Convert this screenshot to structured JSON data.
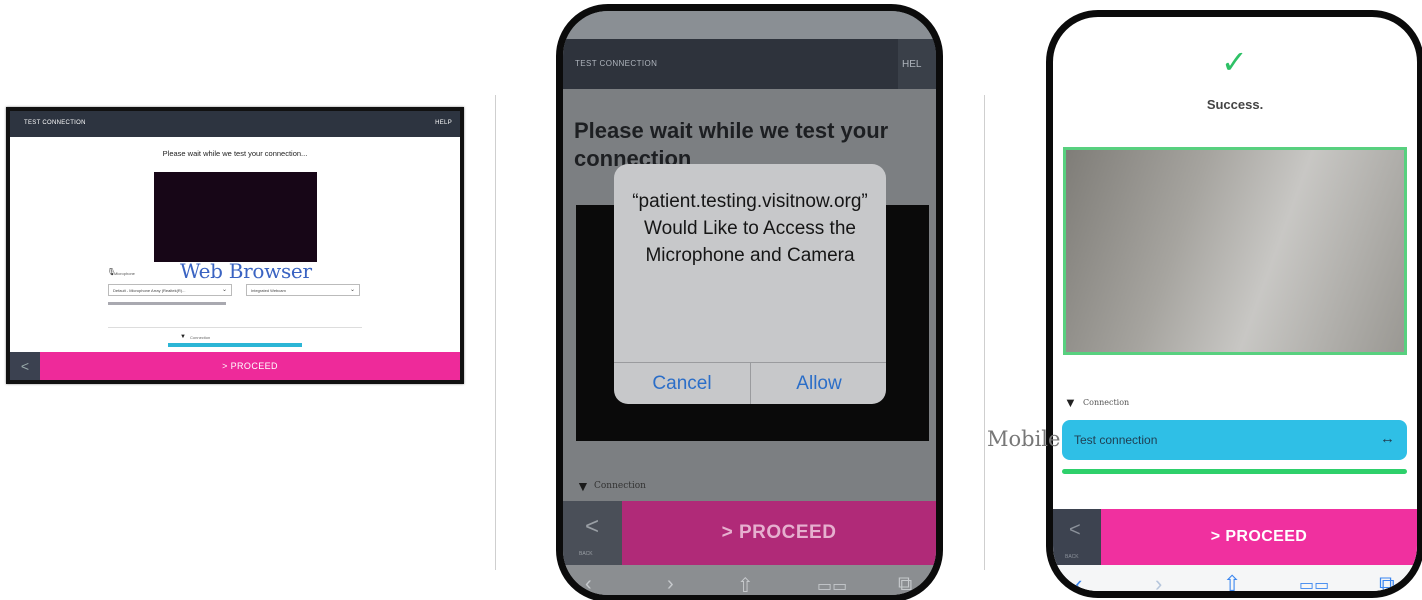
{
  "web": {
    "topbar_title": "TEST CONNECTION",
    "help_label": "HELP",
    "message": "Please wait while we test your connection...",
    "caption": "Web Browser",
    "mic_label": "Microphone",
    "mic_select": "Default - Microphone Array (Realtek(R)...",
    "cam_select": "Integrated Webcam",
    "connection_label": "Connection",
    "back_glyph": "<",
    "proceed": "> PROCEED"
  },
  "phone1": {
    "topbar_title": "TEST CONNECTION",
    "help_label": "HEL",
    "heading": "Please wait while we test your connection",
    "dialog_text": "“patient.testing.visitnow.org” Would Like to Access the Microphone and Camera",
    "cancel": "Cancel",
    "allow": "Allow",
    "connection_label": "Connection",
    "back_glyph": "<",
    "back_label": "BACK",
    "proceed": ">  PROCEED"
  },
  "phone2": {
    "check_glyph": "✓",
    "success": "Success.",
    "connection_label": "Connection",
    "test_connection": "Test connection",
    "test_icon": "↔",
    "back_glyph": "<",
    "back_label": "BACK",
    "proceed": ">  PROCEED"
  },
  "mobile_caption": "Mobile",
  "toolbar_icons": {
    "back": "‹",
    "forward": "›",
    "share": "⇧",
    "bookmarks": "📖",
    "tabs": "⧉"
  },
  "colors": {
    "accent_pink": "#ee2a9a",
    "dark_header": "#2d3440",
    "connection_bar": "#2cb6d6",
    "success_green": "#2ec166",
    "link_blue": "#3a63c2"
  }
}
